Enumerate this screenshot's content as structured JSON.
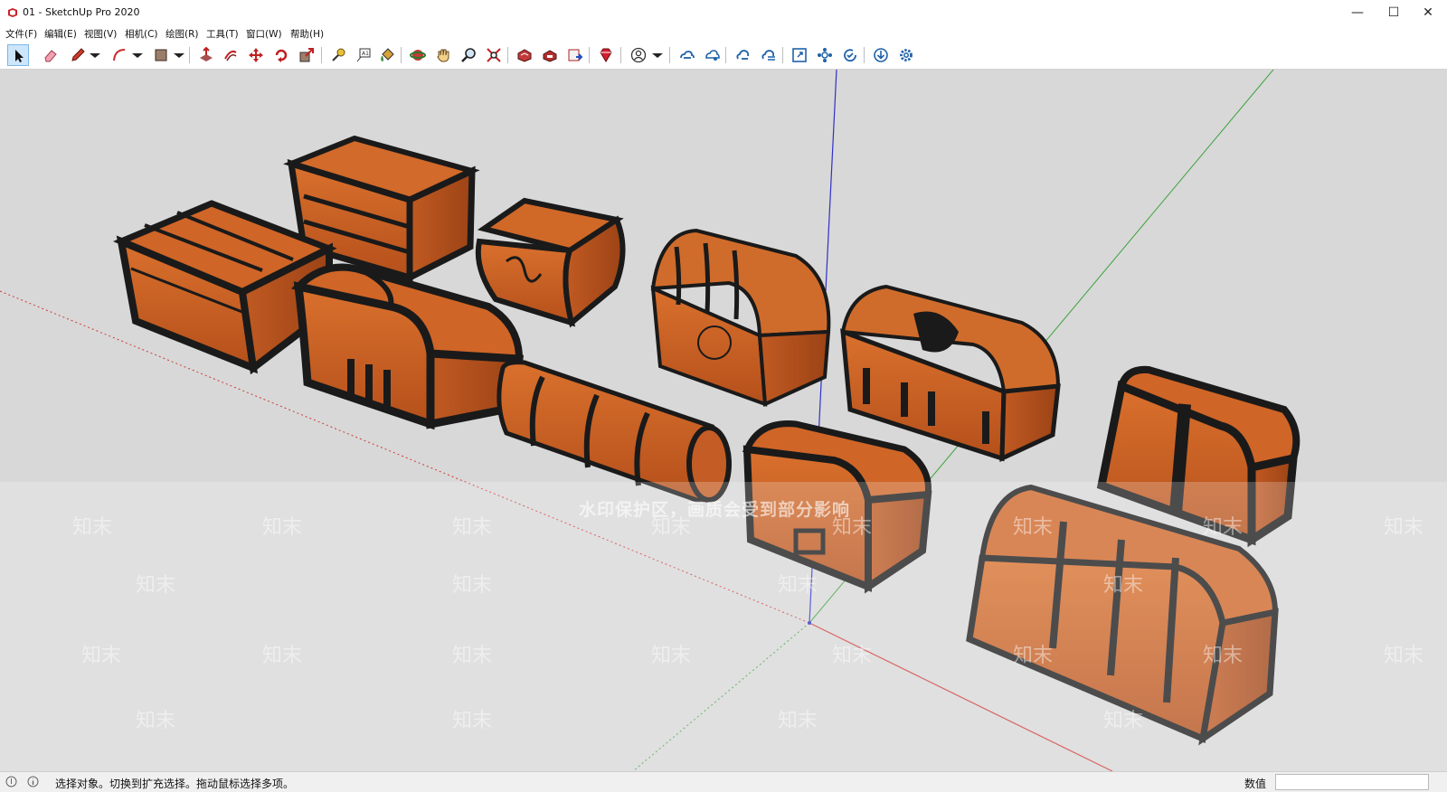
{
  "window": {
    "title": "01 - SketchUp Pro 2020",
    "minimize": "—",
    "maximize": "☐",
    "close": "✕"
  },
  "menu": [
    "文件(F)",
    "编辑(E)",
    "视图(V)",
    "相机(C)",
    "绘图(R)",
    "工具(T)",
    "窗口(W)",
    "帮助(H)"
  ],
  "toolbar": {
    "tools": [
      {
        "name": "select-tool-button",
        "icon": "arrow-icon",
        "active": true
      },
      {
        "name": "eraser-tool-button",
        "icon": "eraser-icon"
      },
      {
        "name": "line-tool-button",
        "icon": "pencil-icon"
      },
      {
        "name": "arc-tool-button",
        "icon": "arc-icon"
      },
      {
        "name": "shapes-tool-button",
        "icon": "rectangle-icon"
      },
      {
        "name": "push-pull-tool-button",
        "icon": "push-pull-icon"
      },
      {
        "name": "offset-tool-button",
        "icon": "offset-icon"
      },
      {
        "name": "move-tool-button",
        "icon": "move-icon"
      },
      {
        "name": "rotate-tool-button",
        "icon": "rotate-icon"
      },
      {
        "name": "scale-tool-button",
        "icon": "scale-icon"
      },
      {
        "name": "tape-measure-tool-button",
        "icon": "tape-measure-icon"
      },
      {
        "name": "text-tool-button",
        "icon": "text-icon"
      },
      {
        "name": "paint-bucket-tool-button",
        "icon": "paint-bucket-icon"
      },
      {
        "name": "orbit-tool-button",
        "icon": "orbit-icon"
      },
      {
        "name": "pan-tool-button",
        "icon": "pan-hand-icon"
      },
      {
        "name": "zoom-tool-button",
        "icon": "magnifier-icon"
      },
      {
        "name": "zoom-extents-button",
        "icon": "zoom-extents-icon"
      },
      {
        "name": "3d-warehouse-button",
        "icon": "warehouse-icon"
      },
      {
        "name": "extension-warehouse-button",
        "icon": "extension-warehouse-icon"
      },
      {
        "name": "send-to-layout-button",
        "icon": "layout-icon"
      },
      {
        "name": "extension-manager-button",
        "icon": "ruby-gem-icon"
      },
      {
        "name": "account-button",
        "icon": "user-icon"
      },
      {
        "name": "trimble-connect-button",
        "icon": "cloud-link-icon"
      },
      {
        "name": "trimble-connect-share-button",
        "icon": "cloud-share-icon"
      },
      {
        "name": "cloud-sync-button",
        "icon": "cloud-sync-icon"
      },
      {
        "name": "cloud-upload-button",
        "icon": "cloud-upload-icon"
      },
      {
        "name": "fullscreen-button",
        "icon": "expand-icon"
      },
      {
        "name": "components-button",
        "icon": "components-icon"
      },
      {
        "name": "refresh-button",
        "icon": "refresh-check-icon"
      },
      {
        "name": "download-button",
        "icon": "download-icon"
      },
      {
        "name": "settings-button",
        "icon": "gear-icon"
      }
    ]
  },
  "viewport": {
    "watermark_text": "水印保护区，画质会受到部分影响",
    "watermark_brand": "知末"
  },
  "status": {
    "message": "选择对象。切换到扩充选择。拖动鼠标选择多项。",
    "measurements_label": "数值",
    "measurements_value": ""
  },
  "colors": {
    "wood": "#c75e23",
    "wood_dark": "#9e4417",
    "iron": "#1a1a1a",
    "sky": "#d8d8d8",
    "axis_red": "#d03030",
    "axis_green": "#3aa23a",
    "axis_blue": "#3030c8"
  }
}
